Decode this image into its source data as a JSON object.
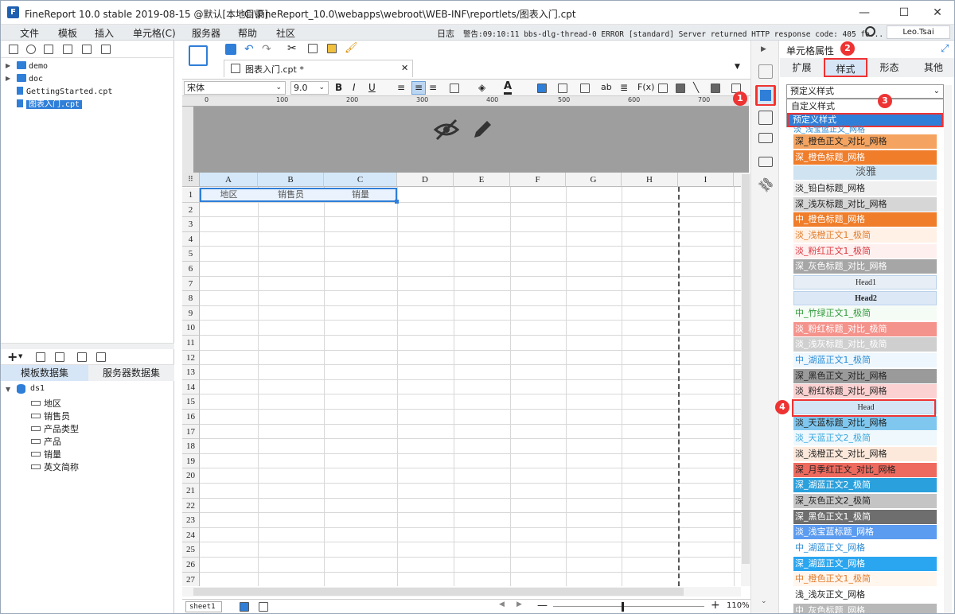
{
  "window": {
    "app_title": "FineReport 10.0 stable 2019-08-15 @默认[本地目录]",
    "file_path": "C:\\FineReport_10.0\\webapps\\webroot\\WEB-INF\\reportlets/图表入门.cpt",
    "minimize": "—",
    "maximize": "☐",
    "close": "✕"
  },
  "menu": {
    "items": [
      "文件",
      "模板",
      "插入",
      "单元格(C)",
      "服务器",
      "帮助",
      "社区"
    ],
    "status_log": "日志",
    "status_warning": "警告:09:10:11 bbs-dlg-thread-0 ERROR [standard] Server returned HTTP response code: 405 fo...",
    "user": "Leo.Tsai"
  },
  "file_tree": {
    "items": [
      {
        "label": "demo",
        "type": "folder"
      },
      {
        "label": "doc",
        "type": "folder"
      },
      {
        "label": "GettingStarted.cpt",
        "type": "file"
      },
      {
        "label": "图表入门.cpt",
        "type": "file",
        "selected": true
      }
    ]
  },
  "dataset_panel": {
    "tab_template": "模板数据集",
    "tab_server": "服务器数据集",
    "dataset_name": "ds1",
    "fields": [
      "地区",
      "销售员",
      "产品类型",
      "产品",
      "销量",
      "英文简称"
    ]
  },
  "editor": {
    "doc_tab": "图表入门.cpt *",
    "font_name": "宋体",
    "font_size": "9.0",
    "ruler_ticks": [
      "0",
      "100",
      "200",
      "300",
      "400",
      "500",
      "600",
      "700"
    ],
    "columns": [
      "A",
      "B",
      "C",
      "D",
      "E",
      "F",
      "G",
      "H",
      "I"
    ],
    "rows": [
      "1",
      "2",
      "3",
      "4",
      "5",
      "6",
      "7",
      "8",
      "9",
      "10",
      "11",
      "12",
      "13",
      "14",
      "15",
      "16",
      "17",
      "18",
      "19",
      "20",
      "21",
      "22",
      "23",
      "24",
      "25",
      "26",
      "27"
    ],
    "cells": {
      "A1": "地区",
      "B1": "销售员",
      "C1": "销量"
    },
    "sheet_tab": "sheet1",
    "zoom": "110%"
  },
  "cell_props": {
    "title": "单元格属性",
    "tabs": [
      "扩展",
      "样式",
      "形态",
      "其他"
    ],
    "active_tab": "样式",
    "style_select": "预定义样式",
    "dropdown_options": [
      "自定义样式",
      "预定义样式"
    ],
    "styles": [
      {
        "label": "深_橙色正文_对比_网格",
        "bg": "#f4a460",
        "fg": "#222"
      },
      {
        "label": "深_橙色标题_网格",
        "bg": "#f07d2a",
        "fg": "#fff"
      },
      {
        "label": "淡雅",
        "bg": "#cfe3f1",
        "fg": "#555"
      },
      {
        "label": "淡_铅白标题_网格",
        "bg": "#f0f0f0",
        "fg": "#222"
      },
      {
        "label": "深_浅灰标题_对比_网格",
        "bg": "#d6d6d6",
        "fg": "#222"
      },
      {
        "label": "中_橙色标题_网格",
        "bg": "#f07d2a",
        "fg": "#fff"
      },
      {
        "label": "淡_浅橙正文1_极简",
        "bg": "#fff1e6",
        "fg": "#e07b2a"
      },
      {
        "label": "淡_粉红正文1_极简",
        "bg": "#fff0f0",
        "fg": "#d9363e"
      },
      {
        "label": "深_灰色标题_对比_网格",
        "bg": "#a6a6a6",
        "fg": "#fff"
      },
      {
        "label": "Head1",
        "bg": "#e8eef5",
        "fg": "#222"
      },
      {
        "label": "Head2",
        "bg": "#dce8f5",
        "fg": "#222"
      },
      {
        "label": "中_竹绿正文1_极简",
        "bg": "#f5fbf5",
        "fg": "#2f9a3a"
      },
      {
        "label": "淡_粉红标题_对比_极简",
        "bg": "#f4938c",
        "fg": "#fff"
      },
      {
        "label": "淡_浅灰标题_对比_极简",
        "bg": "#cfcfcf",
        "fg": "#fff"
      },
      {
        "label": "中_湖蓝正文1_极简",
        "bg": "#eef7fd",
        "fg": "#2a8bd4"
      },
      {
        "label": "深_黑色正文_对比_网格",
        "bg": "#9a9a9a",
        "fg": "#222"
      },
      {
        "label": "淡_粉红标题_对比_网格",
        "bg": "#fbd1d1",
        "fg": "#222"
      },
      {
        "label": "Head",
        "bg": "#d4e6f5",
        "fg": "#222"
      },
      {
        "label": "淡_天蓝标题_对比_网格",
        "bg": "#7fc7ef",
        "fg": "#222"
      },
      {
        "label": "淡_天蓝正文2_极简",
        "bg": "#eef8fd",
        "fg": "#3aa6dd"
      },
      {
        "label": "淡_浅橙正文_对比_网格",
        "bg": "#fde9db",
        "fg": "#222"
      },
      {
        "label": "深_月季红正文_对比_网格",
        "bg": "#ee6a5e",
        "fg": "#222"
      },
      {
        "label": "深_湖蓝正文2_极简",
        "bg": "#2aa0dc",
        "fg": "#fff"
      },
      {
        "label": "深_灰色正文2_极简",
        "bg": "#c4c4c4",
        "fg": "#222"
      },
      {
        "label": "深_黑色正文1_极简",
        "bg": "#6e6e6e",
        "fg": "#fff"
      },
      {
        "label": "淡_浅宝蓝标题_网格",
        "bg": "#5b9bf0",
        "fg": "#fff"
      },
      {
        "label": "中_湖蓝正文_网格",
        "bg": "#ffffff",
        "fg": "#2a8bd4"
      },
      {
        "label": "深_湖蓝正文_网格",
        "bg": "#2aa6f0",
        "fg": "#fff"
      },
      {
        "label": "中_橙色正文1_极简",
        "bg": "#fff6ee",
        "fg": "#e07b2a"
      },
      {
        "label": "浅_浅灰正文_网格",
        "bg": "#ffffff",
        "fg": "#222"
      },
      {
        "label": "中_灰色标题_网格",
        "bg": "#b8b8b8",
        "fg": "#fff"
      }
    ]
  },
  "annotations": [
    "1",
    "2",
    "3",
    "4"
  ],
  "accent": "#2f7ed8",
  "highlight": "#e33333"
}
